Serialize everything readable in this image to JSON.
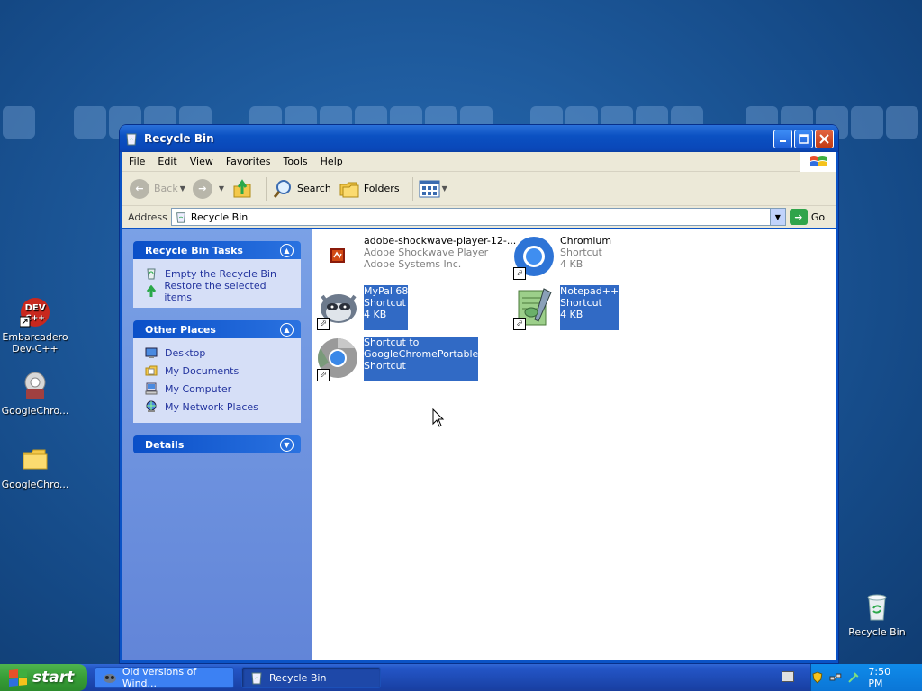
{
  "desktop": {
    "icons": [
      {
        "label": "Embarcadero Dev-C++",
        "icon": "dev-cpp-icon",
        "badge": "DEV C++"
      },
      {
        "label": "GoogleChro...",
        "icon": "chrome-gear-icon"
      },
      {
        "label": "GoogleChro...",
        "icon": "folder-icon"
      },
      {
        "label": "Recycle Bin",
        "icon": "recycle-bin-icon"
      }
    ]
  },
  "window": {
    "title": "Recycle Bin",
    "menu": [
      "File",
      "Edit",
      "View",
      "Favorites",
      "Tools",
      "Help"
    ],
    "toolbar": {
      "back": "Back",
      "search": "Search",
      "folders": "Folders"
    },
    "address": {
      "label": "Address",
      "value": "Recycle Bin",
      "go": "Go"
    }
  },
  "taskpane": {
    "tasks": {
      "title": "Recycle Bin Tasks",
      "items": [
        "Empty the Recycle Bin",
        "Restore the selected items"
      ]
    },
    "places": {
      "title": "Other Places",
      "items": [
        "Desktop",
        "My Documents",
        "My Computer",
        "My Network Places"
      ]
    },
    "details": {
      "title": "Details"
    }
  },
  "files": [
    {
      "name": "adobe-shockwave-player-12-...",
      "line2": "Adobe Shockwave Player",
      "line3": "Adobe Systems Inc.",
      "selected": false,
      "icon": "shockwave-icon"
    },
    {
      "name": "Chromium",
      "line2": "Shortcut",
      "line3": "4 KB",
      "selected": false,
      "icon": "chromium-icon"
    },
    {
      "name": "MyPal 68",
      "line2": "Shortcut",
      "line3": "4 KB",
      "selected": true,
      "icon": "mypal-icon"
    },
    {
      "name": "Notepad++",
      "line2": "Shortcut",
      "line3": "4 KB",
      "selected": true,
      "icon": "notepadpp-icon"
    },
    {
      "name": "Shortcut to",
      "line2": "GoogleChromePortable",
      "line3": "Shortcut",
      "selected": true,
      "icon": "chrome-icon"
    }
  ],
  "taskbar": {
    "start": "start",
    "buttons": [
      "Old versions of Wind...",
      "Recycle Bin"
    ],
    "clock": "7:50 PM"
  },
  "colors": {
    "selection": "#316ac5",
    "titlebar": "#0a53c6",
    "taskpane": "#6e8fdc",
    "start_green": "#3a9e3a"
  }
}
